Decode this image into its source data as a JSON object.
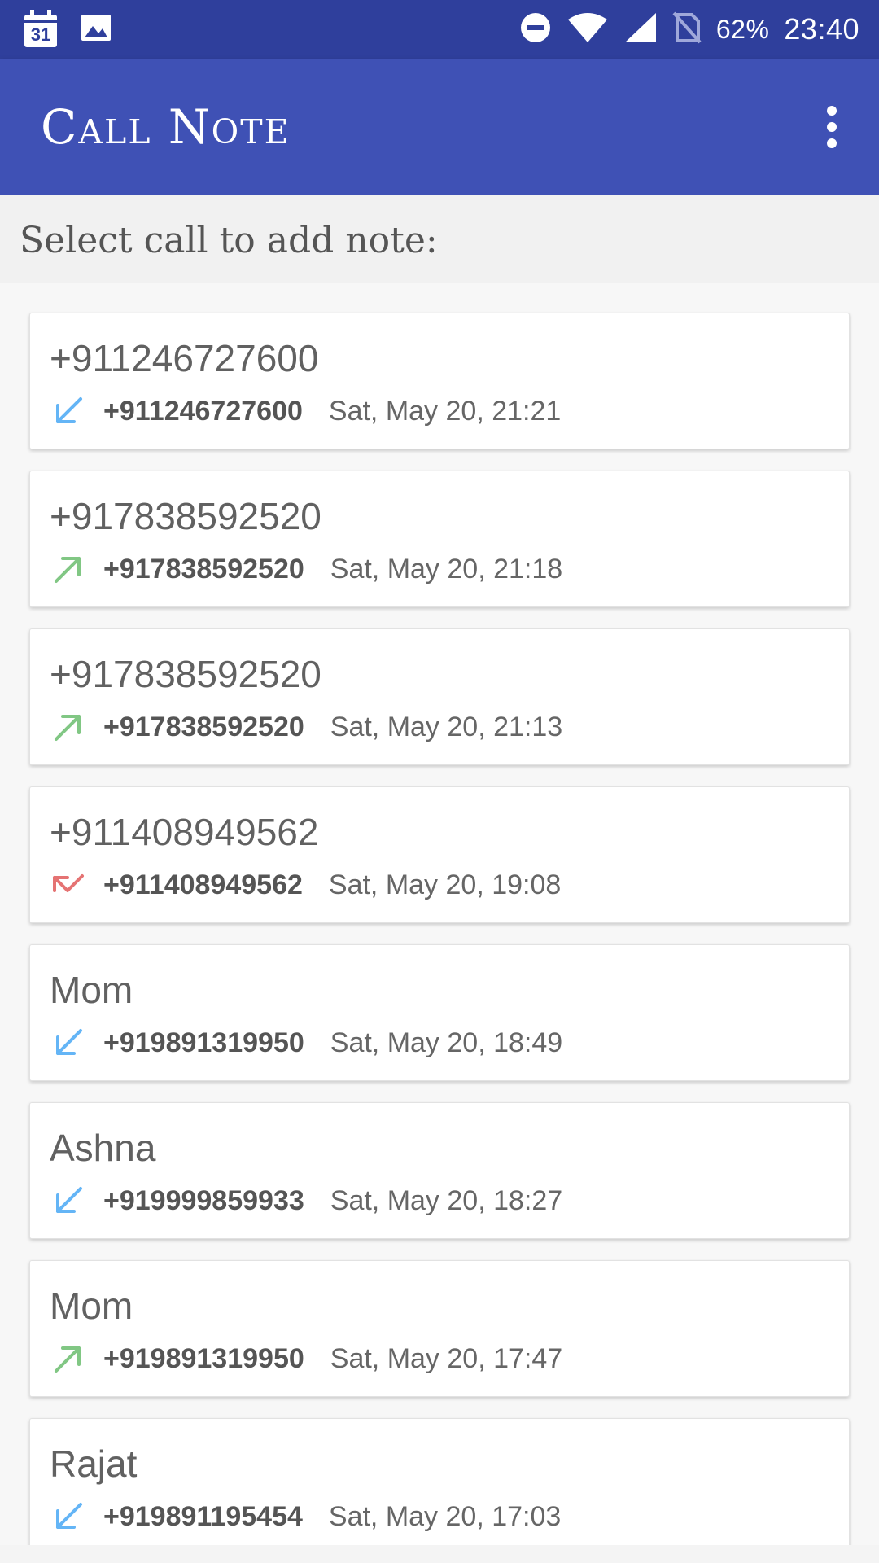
{
  "status_bar": {
    "calendar_date": "31",
    "battery": "62%",
    "time": "23:40"
  },
  "app_bar": {
    "title": "Call Note"
  },
  "prompt": "Select call to add note:",
  "colors": {
    "incoming": "#64b5f6",
    "outgoing": "#81c784",
    "missed": "#e57373"
  },
  "calls": [
    {
      "name": "+911246727600",
      "number": "+911246727600",
      "time": "Sat, May 20, 21:21",
      "type": "incoming"
    },
    {
      "name": "+917838592520",
      "number": "+917838592520",
      "time": "Sat, May 20, 21:18",
      "type": "outgoing"
    },
    {
      "name": "+917838592520",
      "number": "+917838592520",
      "time": "Sat, May 20, 21:13",
      "type": "outgoing"
    },
    {
      "name": "+911408949562",
      "number": "+911408949562",
      "time": "Sat, May 20, 19:08",
      "type": "missed"
    },
    {
      "name": "Mom",
      "number": "+919891319950",
      "time": "Sat, May 20, 18:49",
      "type": "incoming"
    },
    {
      "name": "Ashna",
      "number": "+919999859933",
      "time": "Sat, May 20, 18:27",
      "type": "incoming"
    },
    {
      "name": "Mom",
      "number": "+919891319950",
      "time": "Sat, May 20, 17:47",
      "type": "outgoing"
    },
    {
      "name": "Rajat",
      "number": "+919891195454",
      "time": "Sat, May 20, 17:03",
      "type": "incoming"
    }
  ]
}
